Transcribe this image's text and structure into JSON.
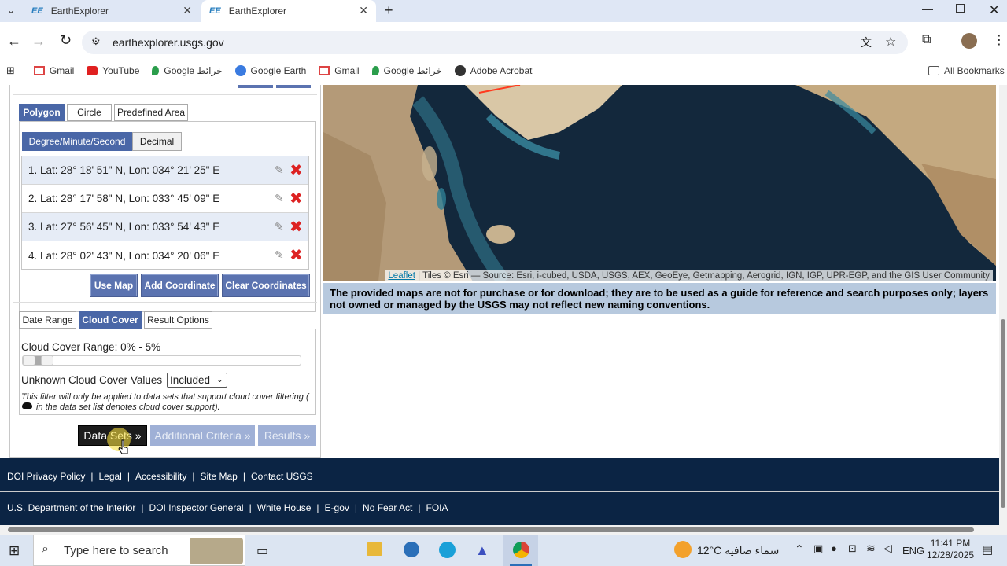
{
  "browser": {
    "tabs": [
      {
        "favicon": "EE",
        "title": "EarthExplorer",
        "active": false
      },
      {
        "favicon": "EE",
        "title": "EarthExplorer",
        "active": true
      }
    ],
    "url": "earthexplorer.usgs.gov",
    "bookmarks": [
      {
        "label": "Gmail",
        "icon": "gmail-icon"
      },
      {
        "label": "YouTube",
        "icon": "youtube-icon"
      },
      {
        "label": "Google خرائط",
        "icon": "maps-pin-icon"
      },
      {
        "label": "Google Earth",
        "icon": "earth-icon"
      },
      {
        "label": "Gmail",
        "icon": "gmail-icon"
      },
      {
        "label": "Google خرائط",
        "icon": "maps-pin-icon"
      },
      {
        "label": "Adobe Acrobat",
        "icon": "acrobat-icon"
      }
    ],
    "all_bookmarks": "All Bookmarks"
  },
  "area_tabs": {
    "polygon": "Polygon",
    "circle": "Circle",
    "predefined": "Predefined Area"
  },
  "format_tabs": {
    "dms": "Degree/Minute/Second",
    "decimal": "Decimal"
  },
  "coordinates": [
    "1.  Lat: 28° 18' 51\" N, Lon: 034° 21' 25\" E",
    "2.  Lat: 28° 17' 58\" N, Lon: 033° 45' 09\" E",
    "3.  Lat: 27° 56' 45\" N, Lon: 033° 54' 43\" E",
    "4.  Lat: 28° 02' 43\" N, Lon: 034° 20' 06\" E"
  ],
  "coord_buttons": {
    "use_map": "Use Map",
    "add": "Add Coordinate",
    "clear": "Clear Coordinates"
  },
  "criteria_tabs": {
    "date_range": "Date Range",
    "cloud_cover": "Cloud Cover",
    "result_options": "Result Options"
  },
  "cloud": {
    "range_label": "Cloud Cover Range: 0% - 5%",
    "range_min": 0,
    "range_max": 5,
    "unknown_label": "Unknown Cloud Cover Values",
    "unknown_selected": "Included",
    "note_line1": "This filter will only be applied to data sets that support cloud cover filtering (",
    "note_line2": "in the data set list denotes cloud cover support)."
  },
  "nav_buttons": {
    "data_sets": "Data Sets »",
    "additional": "Additional Criteria »",
    "results": "Results »"
  },
  "map": {
    "attribution_link": "Leaflet",
    "attribution_text": " | Tiles © Esri — Source: Esri, i-cubed, USDA, USGS, AEX, GeoEye, Getmapping, Aerogrid, IGN, IGP, UPR-EGP, and the GIS User Community"
  },
  "disclaimer": "The provided maps are not for purchase or for download; they are to be used as a guide for reference and search purposes only; layers not owned or managed by the USGS may not reflect new naming conventions.",
  "footer": {
    "row1": [
      "DOI Privacy Policy",
      "Legal",
      "Accessibility",
      "Site Map",
      "Contact USGS"
    ],
    "row2": [
      "U.S. Department of the Interior",
      "DOI Inspector General",
      "White House",
      "E-gov",
      "No Fear Act",
      "FOIA"
    ]
  },
  "taskbar": {
    "search_placeholder": "Type here to search",
    "weather": "12°C  سماء صافية",
    "lang": "ENG",
    "time": "11:41 PM",
    "date": "12/28/2025"
  },
  "colors": {
    "accent": "#4a67a7",
    "footer": "#0b2444",
    "disclaimer": "#b7c9de"
  }
}
